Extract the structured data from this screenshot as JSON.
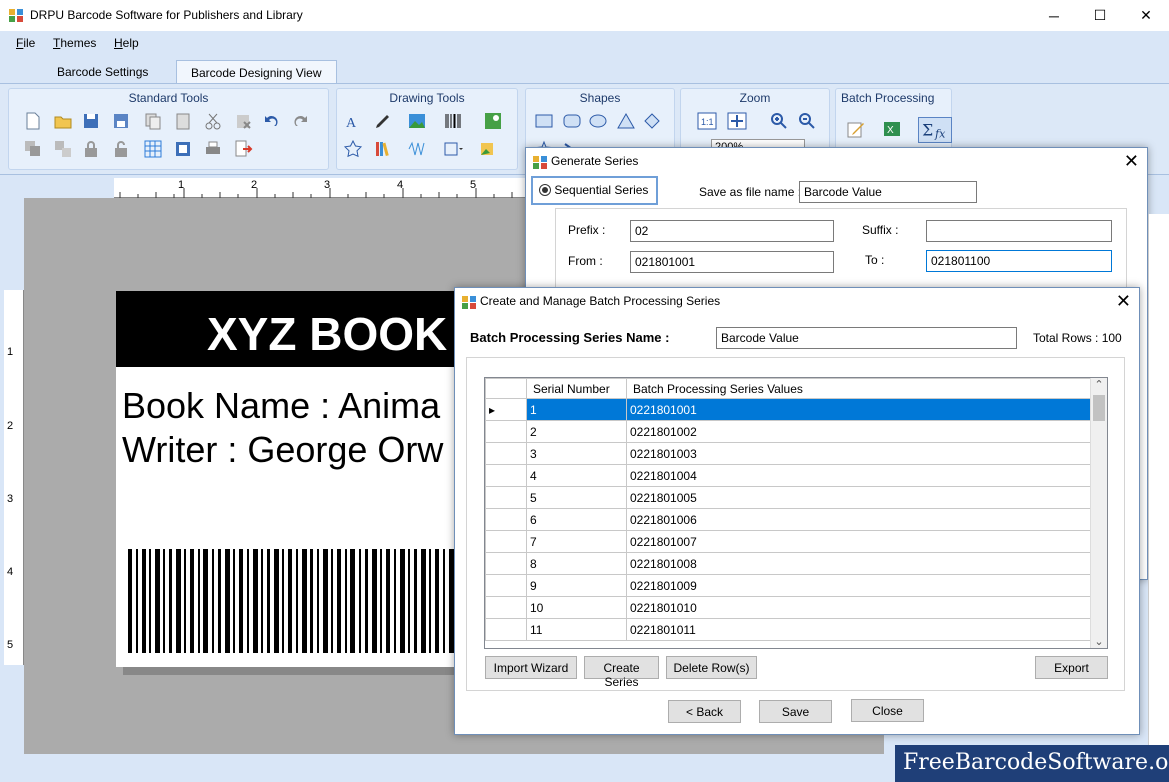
{
  "window": {
    "title": "DRPU Barcode Software for Publishers and Library"
  },
  "menu": [
    "File",
    "Themes",
    "Help"
  ],
  "tabs": [
    {
      "label": "Barcode Settings"
    },
    {
      "label": "Barcode Designing View"
    }
  ],
  "ribbon": {
    "groups": [
      {
        "label": "Standard Tools"
      },
      {
        "label": "Drawing Tools"
      },
      {
        "label": "Shapes"
      },
      {
        "label": "Zoom"
      },
      {
        "label": "Batch Processing"
      }
    ],
    "zoom_value": "200%"
  },
  "ruler": {
    "h": [
      "1",
      "2",
      "3",
      "4",
      "5"
    ],
    "v": [
      "1",
      "2",
      "3",
      "4",
      "5"
    ]
  },
  "label": {
    "header": "XYZ BOOK",
    "line1": "Book Name : Anima",
    "line2": "Writer : George Orw"
  },
  "generate_series": {
    "title": "Generate Series",
    "sequential_label": "Sequential Series",
    "save_as_label": "Save as file name :",
    "save_as_value": "Barcode Value",
    "prefix_label": "Prefix :",
    "prefix_value": "02",
    "suffix_label": "Suffix :",
    "suffix_value": "",
    "from_label": "From :",
    "from_value": "021801001",
    "to_label": "To :",
    "to_value": "021801100"
  },
  "batch_dialog": {
    "title": "Create and Manage Batch Processing Series",
    "name_label": "Batch Processing Series Name :",
    "name_value": "Barcode Value",
    "total_rows": "Total Rows : 100",
    "columns": [
      "Serial Number",
      "Batch Processing Series Values"
    ],
    "rows": [
      [
        "1",
        "0221801001"
      ],
      [
        "2",
        "0221801002"
      ],
      [
        "3",
        "0221801003"
      ],
      [
        "4",
        "0221801004"
      ],
      [
        "5",
        "0221801005"
      ],
      [
        "6",
        "0221801006"
      ],
      [
        "7",
        "0221801007"
      ],
      [
        "8",
        "0221801008"
      ],
      [
        "9",
        "0221801009"
      ],
      [
        "10",
        "0221801010"
      ],
      [
        "11",
        "0221801011"
      ]
    ],
    "buttons": {
      "import": "Import Wizard",
      "create": "Create Series",
      "delete": "Delete Row(s)",
      "export": "Export",
      "back": "< Back",
      "save": "Save",
      "close": "Close"
    }
  },
  "footer": {
    "badge": "FreeBarcodeSoftware.org"
  },
  "colors": {
    "accent": "#0078d7",
    "ribbon": "#dce8f7",
    "badge": "#1f3f78"
  }
}
